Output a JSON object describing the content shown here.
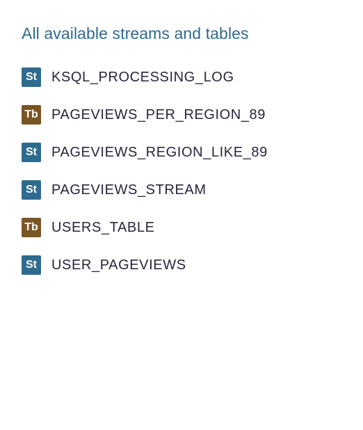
{
  "panel": {
    "title": "All available streams and tables"
  },
  "badge_colors": {
    "St": "#2e6b8f",
    "Tb": "#7a5524"
  },
  "items": [
    {
      "badge": "St",
      "name": "KSQL_PROCESSING_LOG"
    },
    {
      "badge": "Tb",
      "name": "PAGEVIEWS_PER_REGION_89"
    },
    {
      "badge": "St",
      "name": "PAGEVIEWS_REGION_LIKE_89"
    },
    {
      "badge": "St",
      "name": "PAGEVIEWS_STREAM"
    },
    {
      "badge": "Tb",
      "name": "USERS_TABLE"
    },
    {
      "badge": "St",
      "name": "USER_PAGEVIEWS"
    }
  ]
}
